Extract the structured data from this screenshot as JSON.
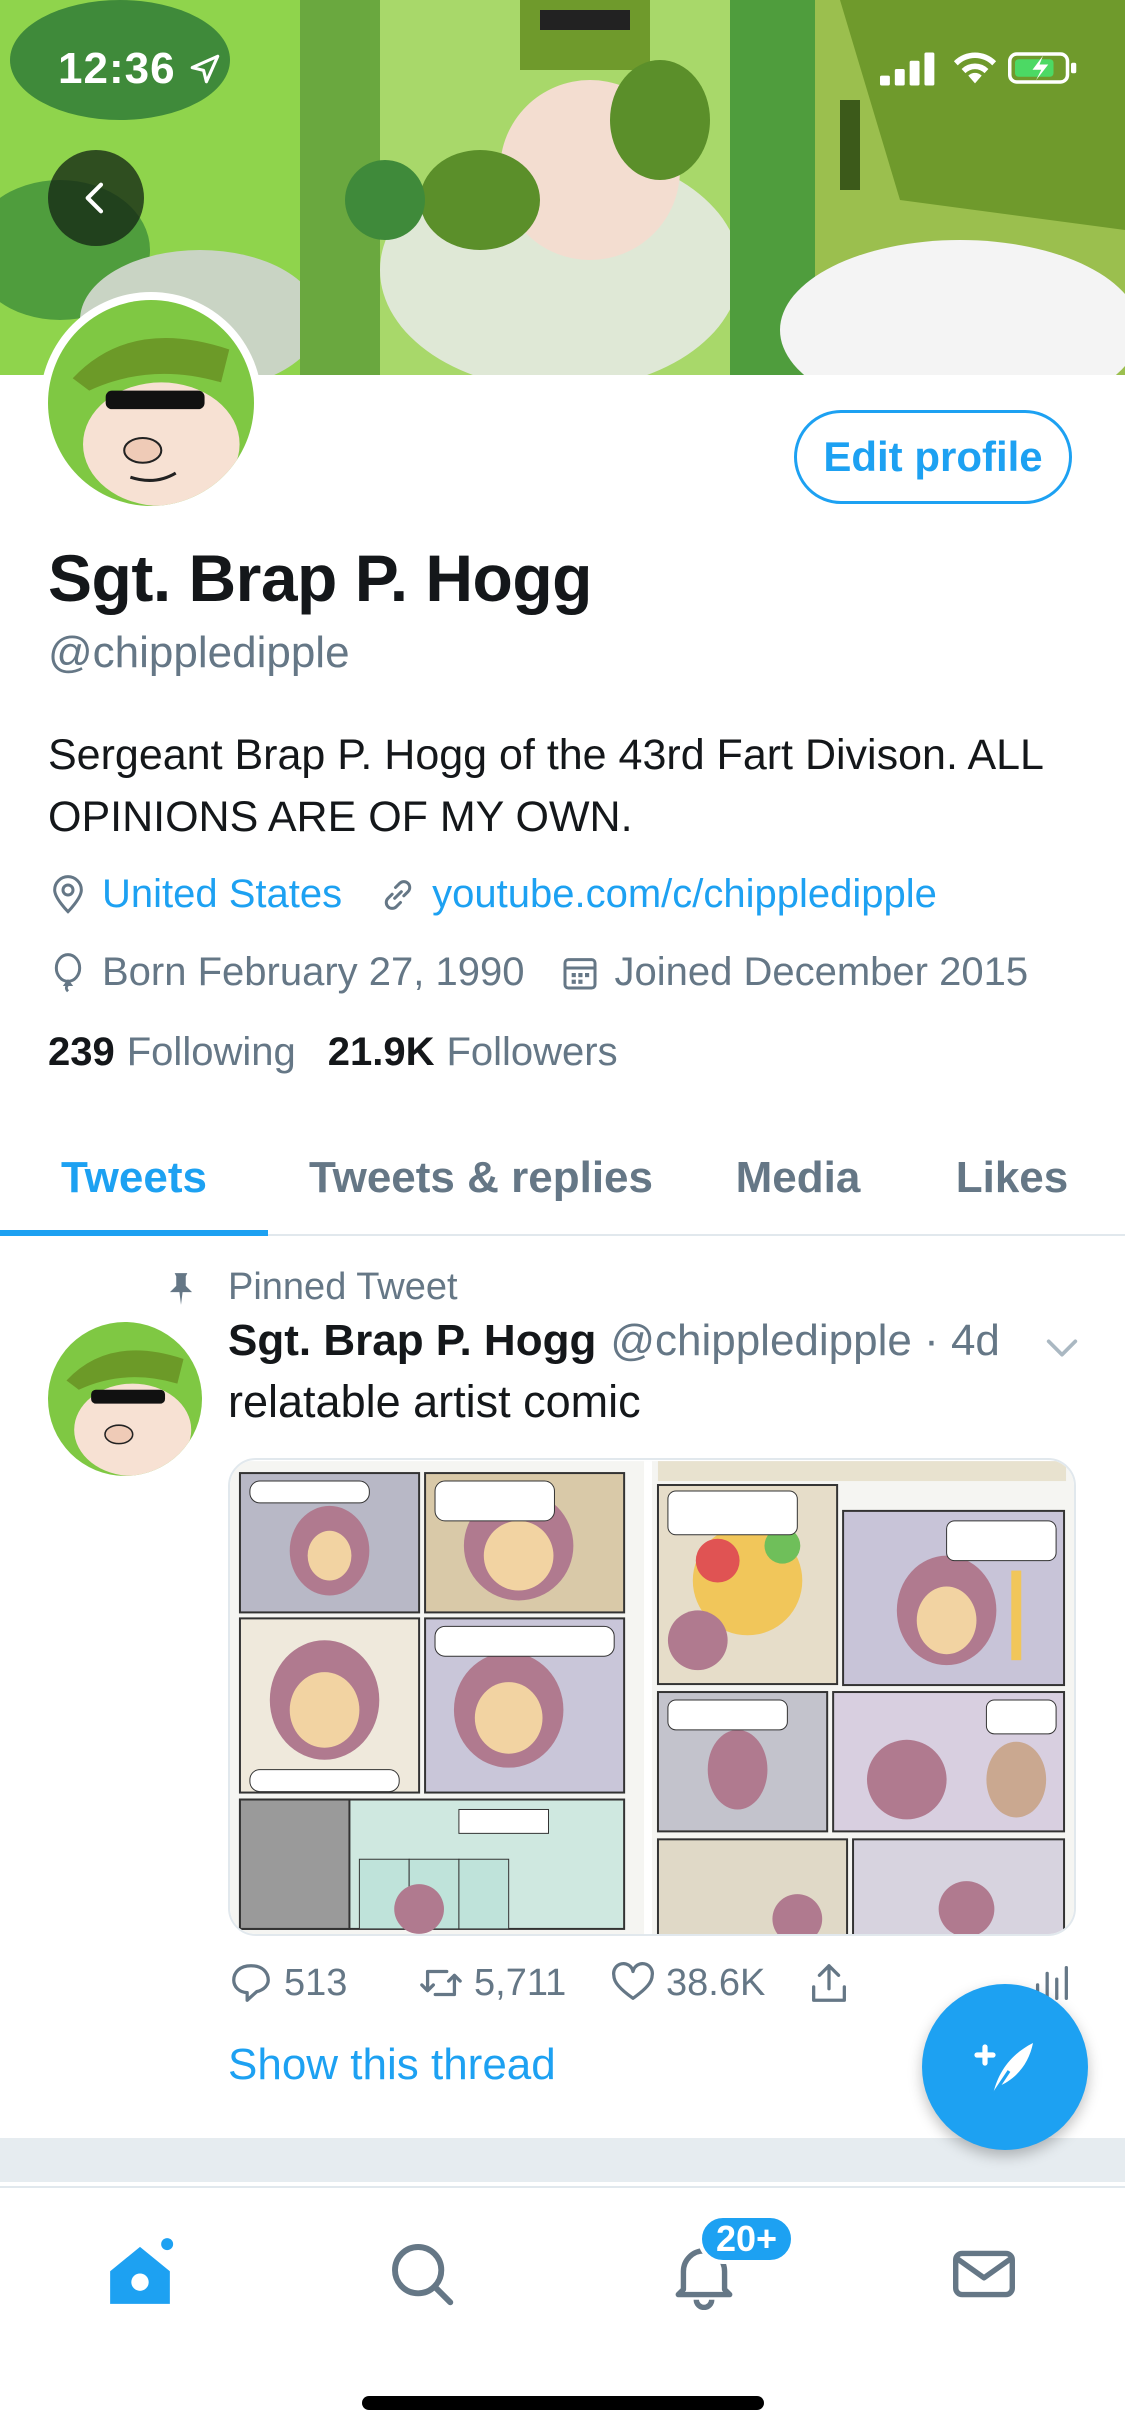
{
  "status_bar": {
    "time": "12:36"
  },
  "profile": {
    "display_name": "Sgt. Brap P. Hogg",
    "handle": "@chippledipple",
    "edit_label": "Edit profile",
    "bio": "Sergeant Brap P. Hogg of the 43rd Fart Divison. ALL OPINIONS ARE OF MY OWN.",
    "location": "United States",
    "website": "youtube.com/c/chippledipple",
    "birthday": "Born February 27, 1990",
    "joined": "Joined December 2015",
    "following_count": "239",
    "following_label": "Following",
    "followers_count": "21.9K",
    "followers_label": "Followers"
  },
  "tabs": [
    {
      "label": "Tweets",
      "active": true
    },
    {
      "label": "Tweets & replies",
      "active": false
    },
    {
      "label": "Media",
      "active": false
    },
    {
      "label": "Likes",
      "active": false
    }
  ],
  "tweet": {
    "pinned_label": "Pinned Tweet",
    "author_name": "Sgt. Brap P. Hogg",
    "author_handle_time": "@chippledipple · 4d",
    "text": "relatable artist comic",
    "replies": "513",
    "retweets": "5,711",
    "likes": "38.6K",
    "show_thread": "Show this thread"
  },
  "bottom_nav": {
    "items": [
      "home-icon",
      "search-icon",
      "notifications-icon",
      "messages-icon"
    ],
    "notification_badge": "20+"
  },
  "colors": {
    "accent": "#1da1f2",
    "secondary_text": "#657786",
    "banner_green": "#8ed14a"
  }
}
